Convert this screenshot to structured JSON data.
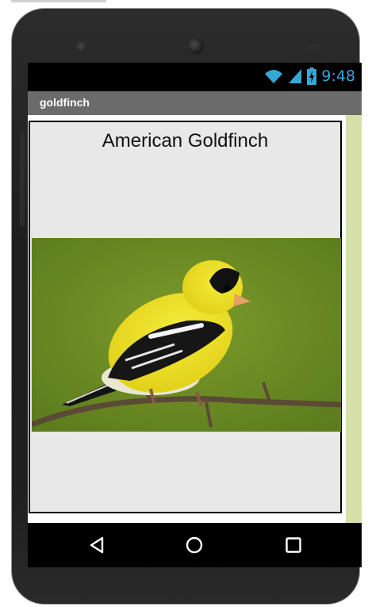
{
  "app": {
    "title": "goldfinch"
  },
  "status_bar": {
    "time": "9:48",
    "icons": [
      "wifi-icon",
      "signal-icon",
      "battery-charging-icon"
    ],
    "accent_color": "#36a8d6"
  },
  "screen": {
    "heading": "American Goldfinch",
    "image": {
      "subject": "American Goldfinch perched on a branch",
      "icon": "goldfinch-photo"
    }
  },
  "nav_bar": {
    "icons": [
      "back-icon",
      "home-icon",
      "recents-icon"
    ]
  },
  "colors": {
    "title_bar": "#6b6b6b",
    "arrangement_bg": "#e8e8e8",
    "side_strip": "#d5e0a8"
  }
}
